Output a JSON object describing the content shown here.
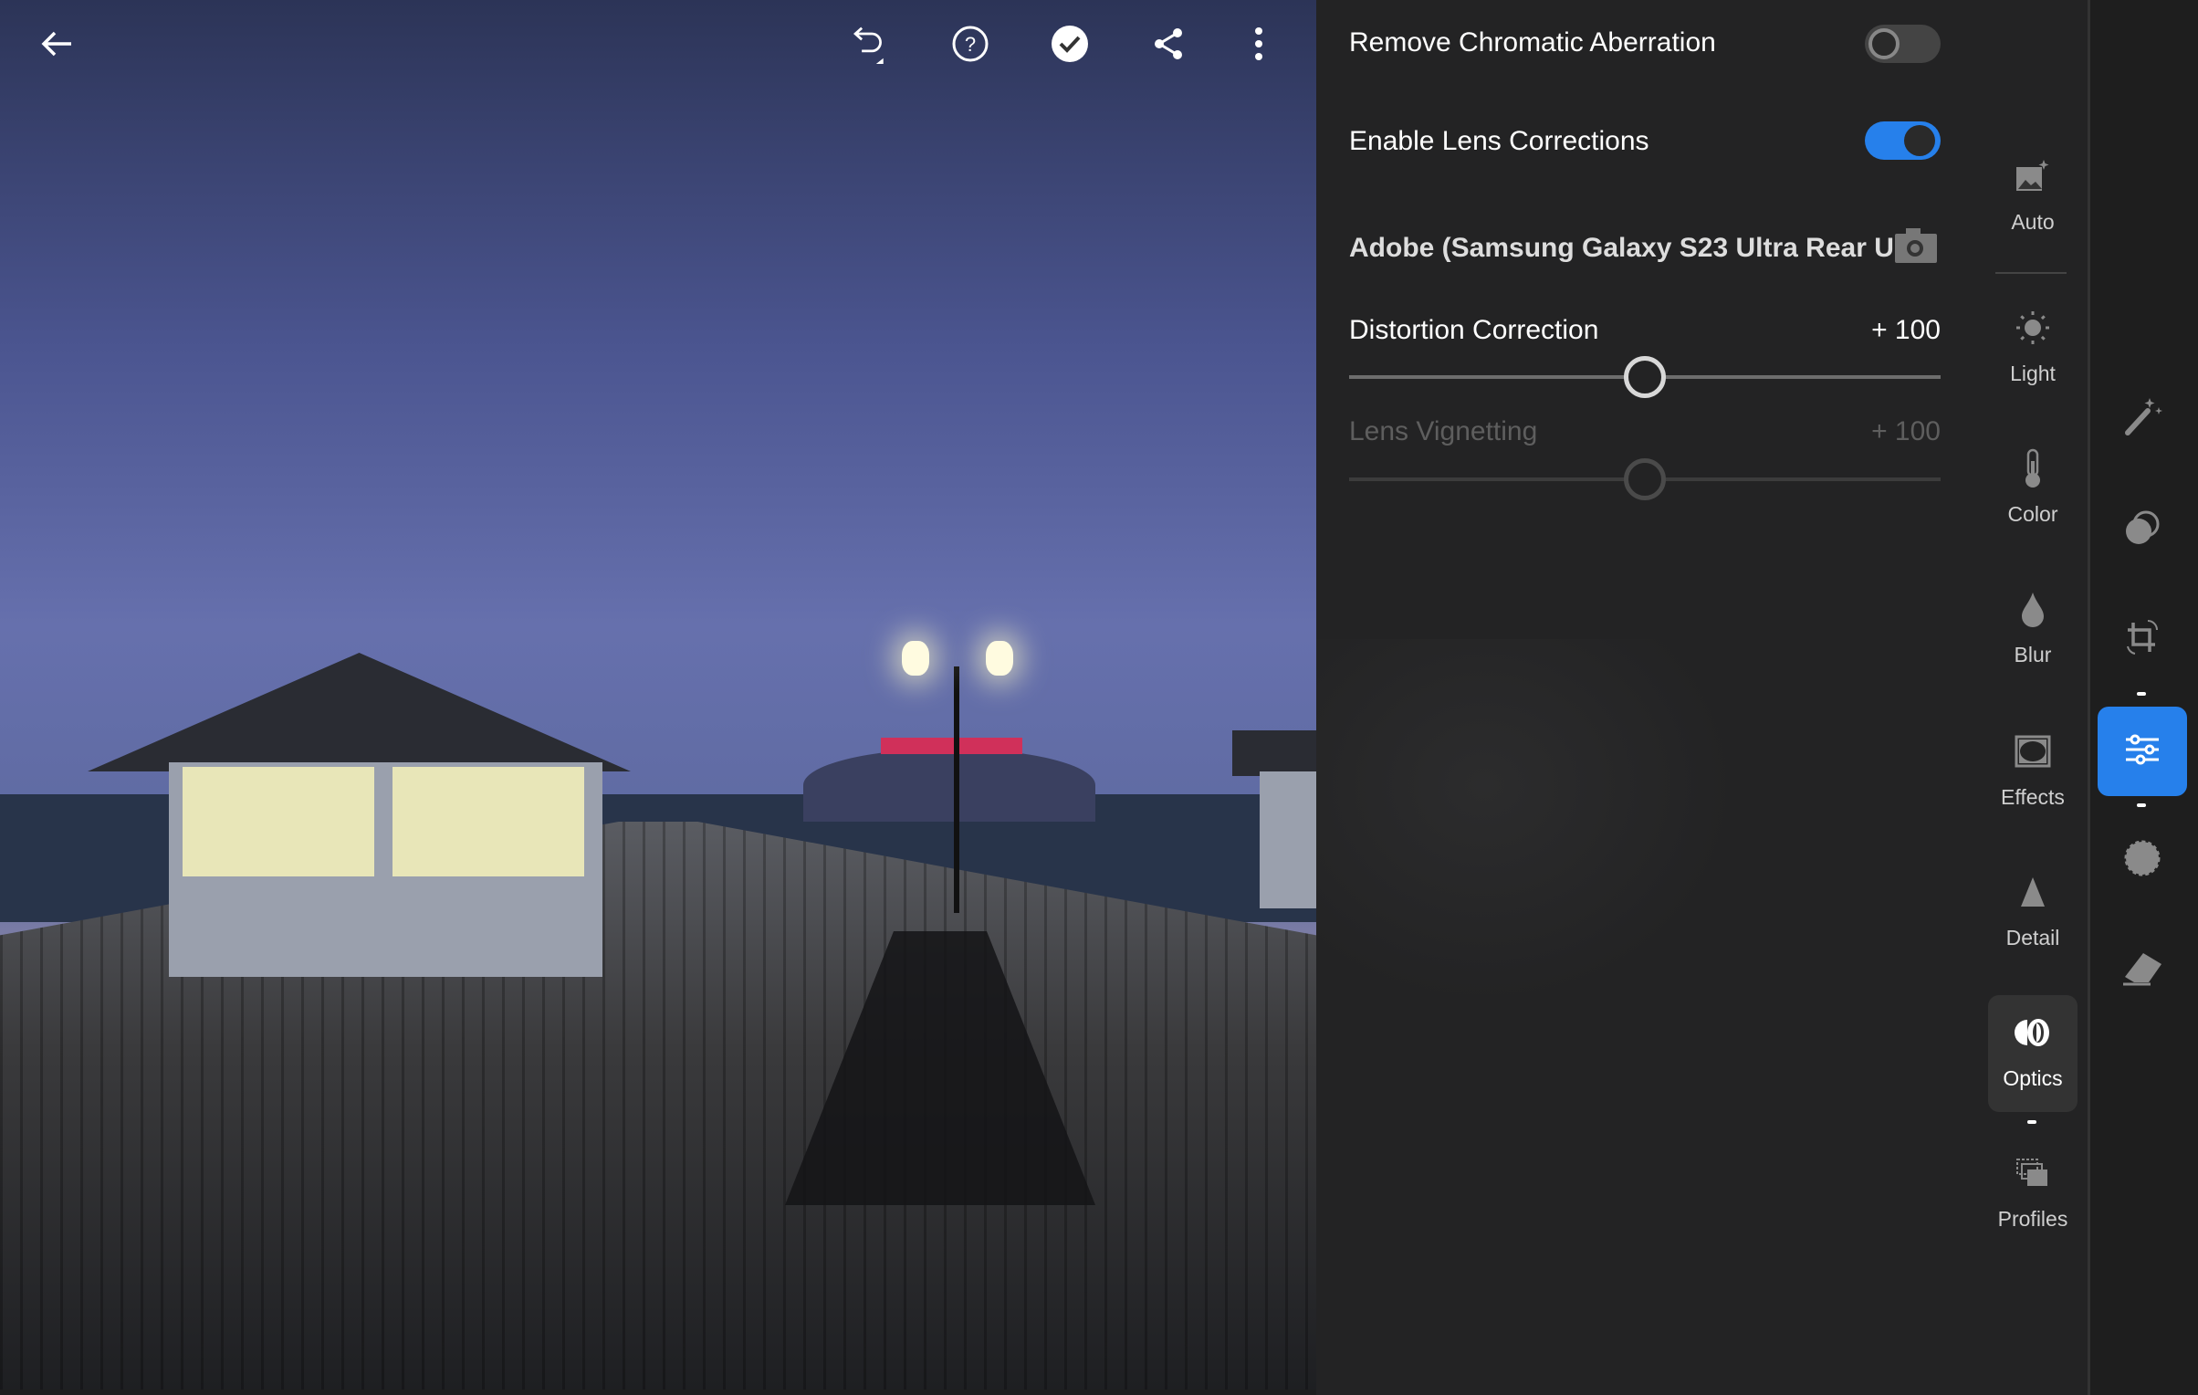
{
  "topbar": {
    "icons": [
      "back-arrow-icon",
      "undo-icon",
      "help-icon",
      "done-check-icon",
      "share-icon",
      "more-vertical-icon"
    ]
  },
  "optics": {
    "remove_ca": {
      "label": "Remove Chromatic Aberration",
      "on": false
    },
    "lens_corrections": {
      "label": "Enable Lens Corrections",
      "on": true
    },
    "profile": {
      "label": "Adobe (Samsung Galaxy S23 Ultra Rear Ul...",
      "icon": "camera-icon"
    },
    "distortion": {
      "label": "Distortion Correction",
      "value": "+ 100",
      "level": 100
    },
    "vignetting": {
      "label": "Lens Vignetting",
      "value": "+ 100",
      "level": 100,
      "disabled": true
    }
  },
  "categories": [
    {
      "label": "Auto",
      "icon": "auto-image-icon"
    },
    {
      "label": "Light",
      "icon": "sun-icon"
    },
    {
      "label": "Color",
      "icon": "thermometer-icon"
    },
    {
      "label": "Blur",
      "icon": "droplet-icon"
    },
    {
      "label": "Effects",
      "icon": "vignette-frame-icon"
    },
    {
      "label": "Detail",
      "icon": "triangle-icon"
    },
    {
      "label": "Optics",
      "icon": "lens-icon",
      "active": true
    },
    {
      "label": "Profiles",
      "icon": "profiles-icon"
    }
  ],
  "tools": [
    "magic-wand-icon",
    "masking-icon",
    "crop-icon",
    "edit-sliders-icon",
    "healing-icon",
    "eraser-icon"
  ],
  "colors": {
    "accent": "#2680eb",
    "panel": "#232324"
  }
}
